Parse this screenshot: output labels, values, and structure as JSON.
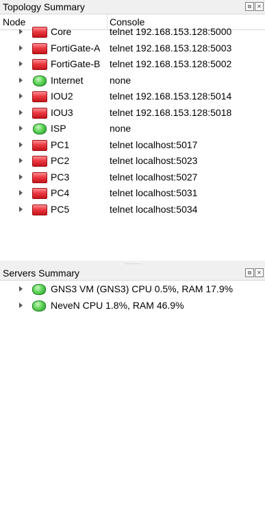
{
  "topology": {
    "title": "Topology Summary",
    "columns": {
      "node": "Node",
      "console": "Console"
    },
    "nodes": [
      {
        "name": "Core",
        "console": "telnet 192.168.153.128:5000",
        "status": "stopped"
      },
      {
        "name": "FortiGate-A",
        "console": "telnet 192.168.153.128:5003",
        "status": "stopped"
      },
      {
        "name": "FortiGate-B",
        "console": "telnet 192.168.153.128:5002",
        "status": "stopped"
      },
      {
        "name": "Internet",
        "console": "none",
        "status": "running"
      },
      {
        "name": "IOU2",
        "console": "telnet 192.168.153.128:5014",
        "status": "stopped"
      },
      {
        "name": "IOU3",
        "console": "telnet 192.168.153.128:5018",
        "status": "stopped"
      },
      {
        "name": "ISP",
        "console": "none",
        "status": "running"
      },
      {
        "name": "PC1",
        "console": "telnet localhost:5017",
        "status": "stopped"
      },
      {
        "name": "PC2",
        "console": "telnet localhost:5023",
        "status": "stopped"
      },
      {
        "name": "PC3",
        "console": "telnet localhost:5027",
        "status": "stopped"
      },
      {
        "name": "PC4",
        "console": "telnet localhost:5031",
        "status": "stopped"
      },
      {
        "name": "PC5",
        "console": "telnet localhost:5034",
        "status": "stopped"
      }
    ]
  },
  "servers": {
    "title": "Servers Summary",
    "items": [
      {
        "text": "GNS3 VM (GNS3) CPU 0.5%, RAM 17.9%",
        "status": "running"
      },
      {
        "text": "NeveN CPU 1.8%, RAM 46.9%",
        "status": "running"
      }
    ]
  },
  "dock_buttons": {
    "float": "⧉",
    "close": "✕"
  },
  "colors": {
    "stopped": "#e8323a",
    "running": "#4cc94a",
    "pane_bg": "#ffffff",
    "chrome_bg": "#f0f0f0"
  },
  "icons": {
    "expand": "triangle-right-icon",
    "stopped_node": "red-device-icon",
    "running_node": "green-device-icon"
  }
}
